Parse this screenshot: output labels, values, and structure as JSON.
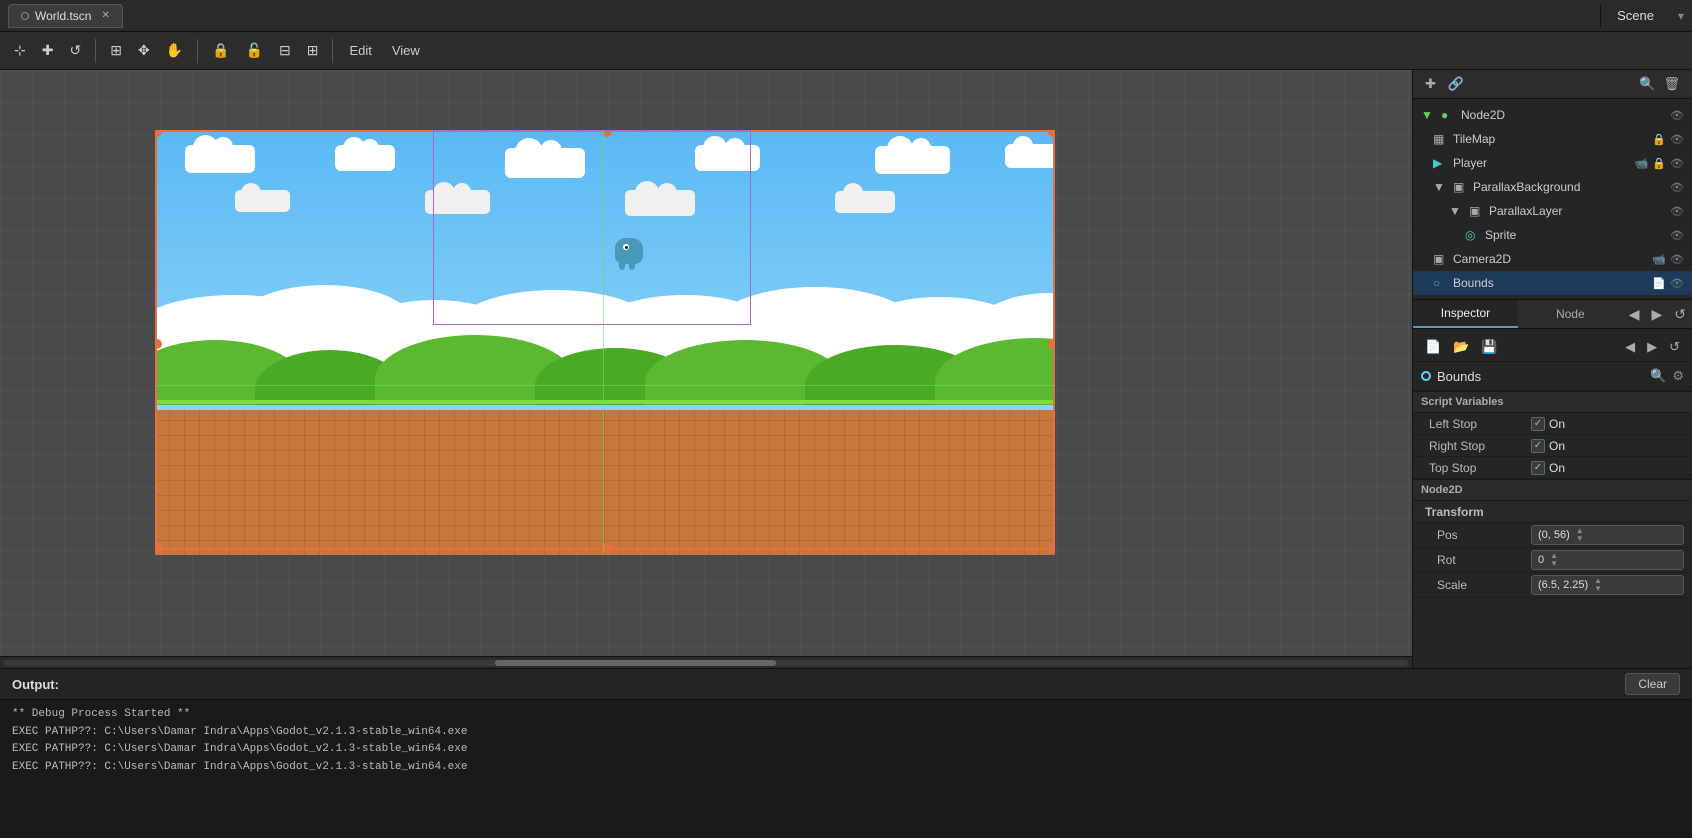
{
  "tab": {
    "label": "World.tscn",
    "dot": "○"
  },
  "toolbar": {
    "edit_label": "Edit",
    "view_label": "View"
  },
  "scene_panel": {
    "title": "Scene"
  },
  "scene_tree": {
    "items": [
      {
        "id": "node2d",
        "label": "Node2D",
        "indent": 0,
        "icon": "●",
        "icon_color": "dot-green",
        "selected": false,
        "has_eye": true
      },
      {
        "id": "tilemap",
        "label": "TileMap",
        "indent": 1,
        "icon": "▦",
        "icon_color": "dot-white",
        "selected": false,
        "has_lock": true,
        "has_eye": true
      },
      {
        "id": "player",
        "label": "Player",
        "indent": 1,
        "icon": "▶",
        "icon_color": "dot-cyan",
        "selected": false,
        "has_cam": true,
        "has_lock2": true,
        "has_eye": true
      },
      {
        "id": "parallaxbg",
        "label": "ParallaxBackground",
        "indent": 1,
        "icon": "▣",
        "icon_color": "dot-white",
        "selected": false,
        "has_eye": true
      },
      {
        "id": "parallaxlayer",
        "label": "ParallaxLayer",
        "indent": 2,
        "icon": "▣",
        "icon_color": "dot-white",
        "selected": false,
        "has_eye": true
      },
      {
        "id": "sprite",
        "label": "Sprite",
        "indent": 3,
        "icon": "◎",
        "icon_color": "dot-cyan",
        "selected": false,
        "has_eye": true
      },
      {
        "id": "camera2d",
        "label": "Camera2D",
        "indent": 1,
        "icon": "▣",
        "icon_color": "dot-white",
        "selected": false,
        "has_cam2": true,
        "has_eye": true
      },
      {
        "id": "bounds",
        "label": "Bounds",
        "indent": 1,
        "icon": "○",
        "icon_color": "dot-blue",
        "selected": true,
        "has_eye": true
      }
    ]
  },
  "inspector": {
    "tab_inspector": "Inspector",
    "tab_node": "Node",
    "node_name": "Bounds",
    "sections": {
      "script_variables": "Script Variables",
      "node2d": "Node2D",
      "transform": "Transform"
    },
    "properties": {
      "left_stop_label": "Left Stop",
      "left_stop_checked": true,
      "left_stop_value": "On",
      "right_stop_label": "Right Stop",
      "right_stop_checked": true,
      "right_stop_value": "On",
      "top_stop_label": "Top Stop",
      "top_stop_checked": true,
      "top_stop_value": "On",
      "pos_label": "Pos",
      "pos_value": "(0, 56)",
      "rot_label": "Rot",
      "rot_value": "0",
      "scale_label": "Scale",
      "scale_value": "(6.5, 2.25)"
    }
  },
  "output": {
    "title": "Output:",
    "clear_btn": "Clear",
    "lines": [
      "** Debug Process Started **",
      "EXEC PATHP??: C:\\Users\\Damar Indra\\Apps\\Godot_v2.1.3-stable_win64.exe",
      "EXEC PATHP??: C:\\Users\\Damar Indra\\Apps\\Godot_v2.1.3-stable_win64.exe",
      "EXEC PATHP??: C:\\Users\\Damar Indra\\Apps\\Godot_v2.1.3-stable_win64.exe"
    ]
  }
}
